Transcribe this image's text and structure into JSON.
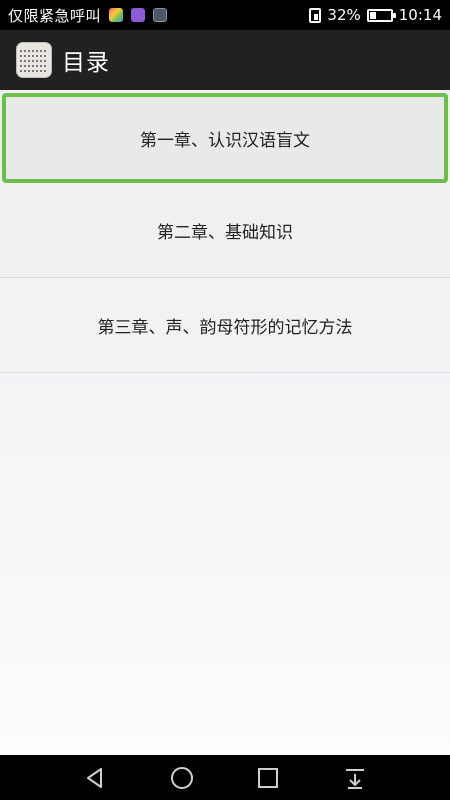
{
  "status_bar": {
    "carrier": "仅限紧急呼叫",
    "battery": "32%",
    "time": "10:14",
    "icons": [
      "photos-app-icon",
      "purple-app-icon",
      "gallery-app-icon",
      "sim-icon",
      "battery-icon"
    ]
  },
  "app_bar": {
    "title": "目录",
    "icon": "braille-app-icon"
  },
  "chapters": [
    {
      "label": "第一章、认识汉语盲文",
      "selected": true
    },
    {
      "label": "第二章、基础知识",
      "selected": false
    },
    {
      "label": "第三章、声、韵母符形的记忆方法",
      "selected": false
    }
  ],
  "nav_bar": {
    "icons": [
      "back-icon",
      "home-icon",
      "recents-icon",
      "notification-pull-icon"
    ]
  },
  "colors": {
    "selection_border": "#6cc04a",
    "app_bar_bg": "#212121",
    "status_bar_bg": "#000000"
  }
}
